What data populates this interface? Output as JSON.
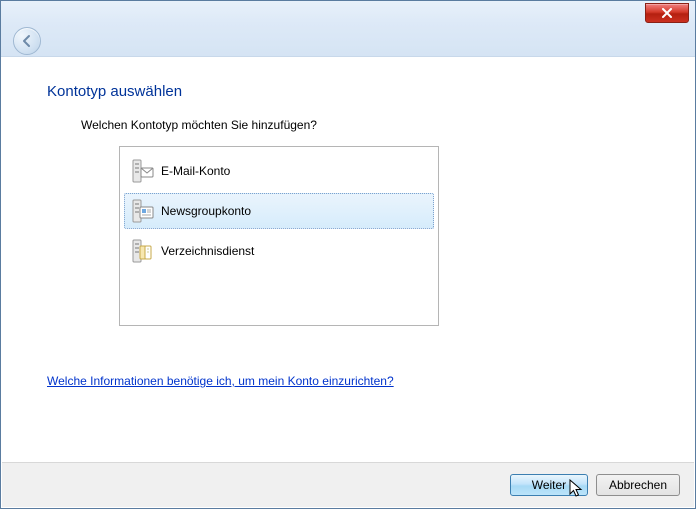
{
  "page": {
    "title": "Kontotyp auswählen",
    "prompt": "Welchen Kontotyp möchten Sie hinzufügen?"
  },
  "options": {
    "email": {
      "label": "E-Mail-Konto"
    },
    "newsgroup": {
      "label": "Newsgroupkonto"
    },
    "directory": {
      "label": "Verzeichnisdienst"
    }
  },
  "help": {
    "link_text": "Welche Informationen benötige ich, um mein Konto einzurichten?"
  },
  "buttons": {
    "next": "Weiter",
    "cancel": "Abbrechen"
  }
}
